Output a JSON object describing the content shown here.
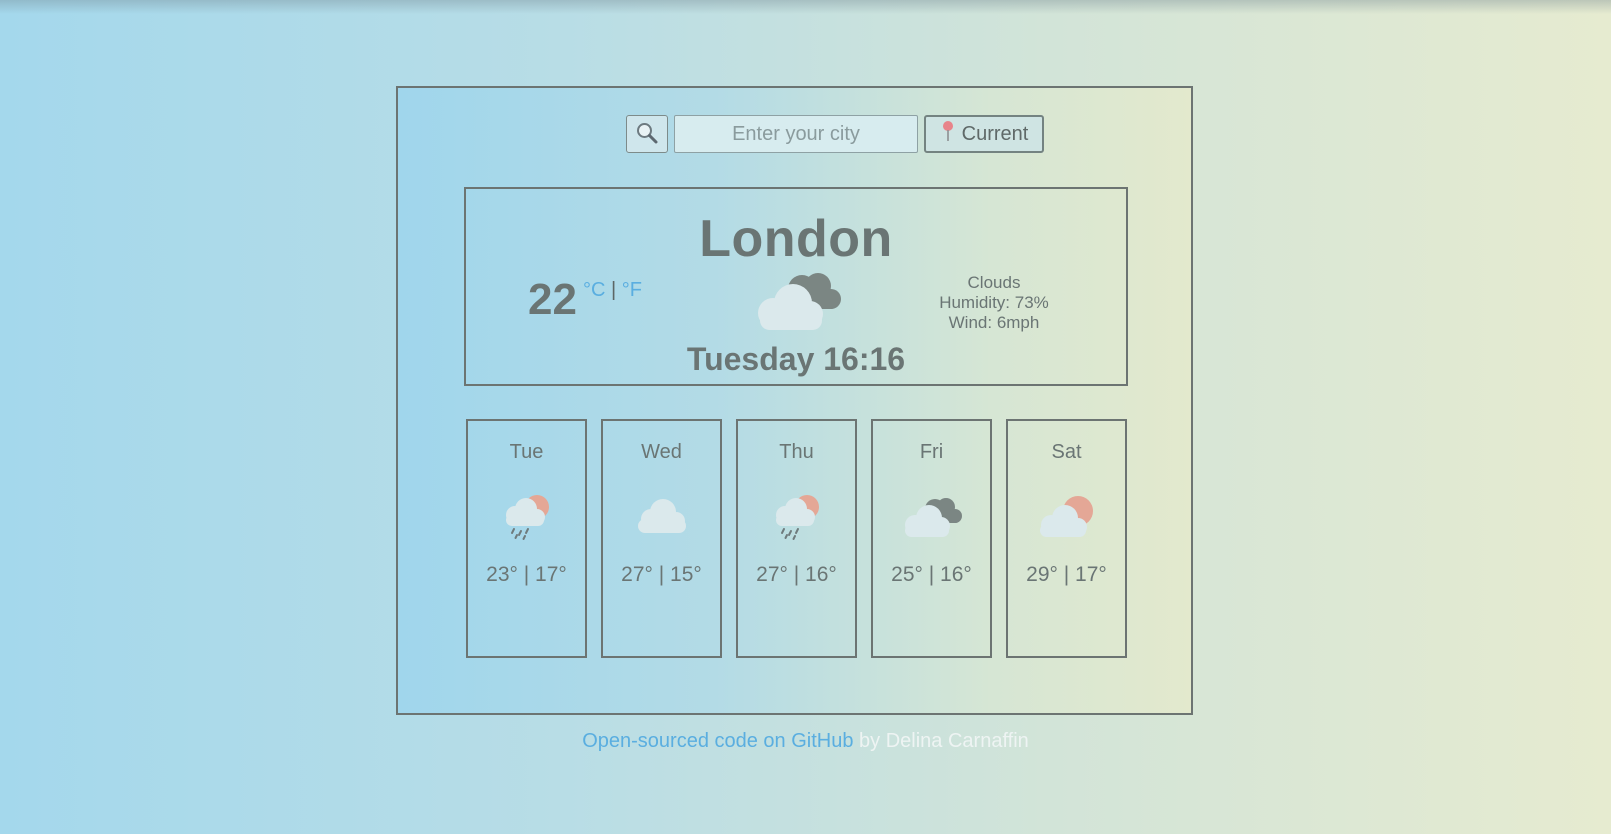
{
  "search": {
    "search_icon": "magnifier-icon",
    "placeholder": "Enter your city",
    "value": "",
    "current_icon": "pushpin-icon",
    "current_label": "Current"
  },
  "today": {
    "city": "London",
    "temperature": "22",
    "unit_c": "°C",
    "unit_separator": "|",
    "unit_f": "°F",
    "icon": "cloudy-icon",
    "description": "Clouds",
    "humidity": "Humidity: 73%",
    "wind": "Wind: 6mph",
    "datetime": "Tuesday 16:16"
  },
  "forecast": [
    {
      "day": "Tue",
      "icon": "sun-cloud-rain-icon",
      "temps": "23° | 17°"
    },
    {
      "day": "Wed",
      "icon": "cloud-icon",
      "temps": "27° | 15°"
    },
    {
      "day": "Thu",
      "icon": "sun-cloud-rain-icon",
      "temps": "27° | 16°"
    },
    {
      "day": "Fri",
      "icon": "cloudy-icon",
      "temps": "25° | 16°"
    },
    {
      "day": "Sat",
      "icon": "sun-behind-cloud-icon",
      "temps": "29° | 17°"
    }
  ],
  "footer": {
    "link_text": "Open-sourced code on GitHub",
    "byline": " by Delina Carnaffin"
  },
  "colors": {
    "accent_link": "#5aaee0",
    "border": "#6c7472",
    "text": "#6a7574",
    "gradient_left": "#a4d8ec",
    "gradient_right": "#e6ebd0"
  }
}
